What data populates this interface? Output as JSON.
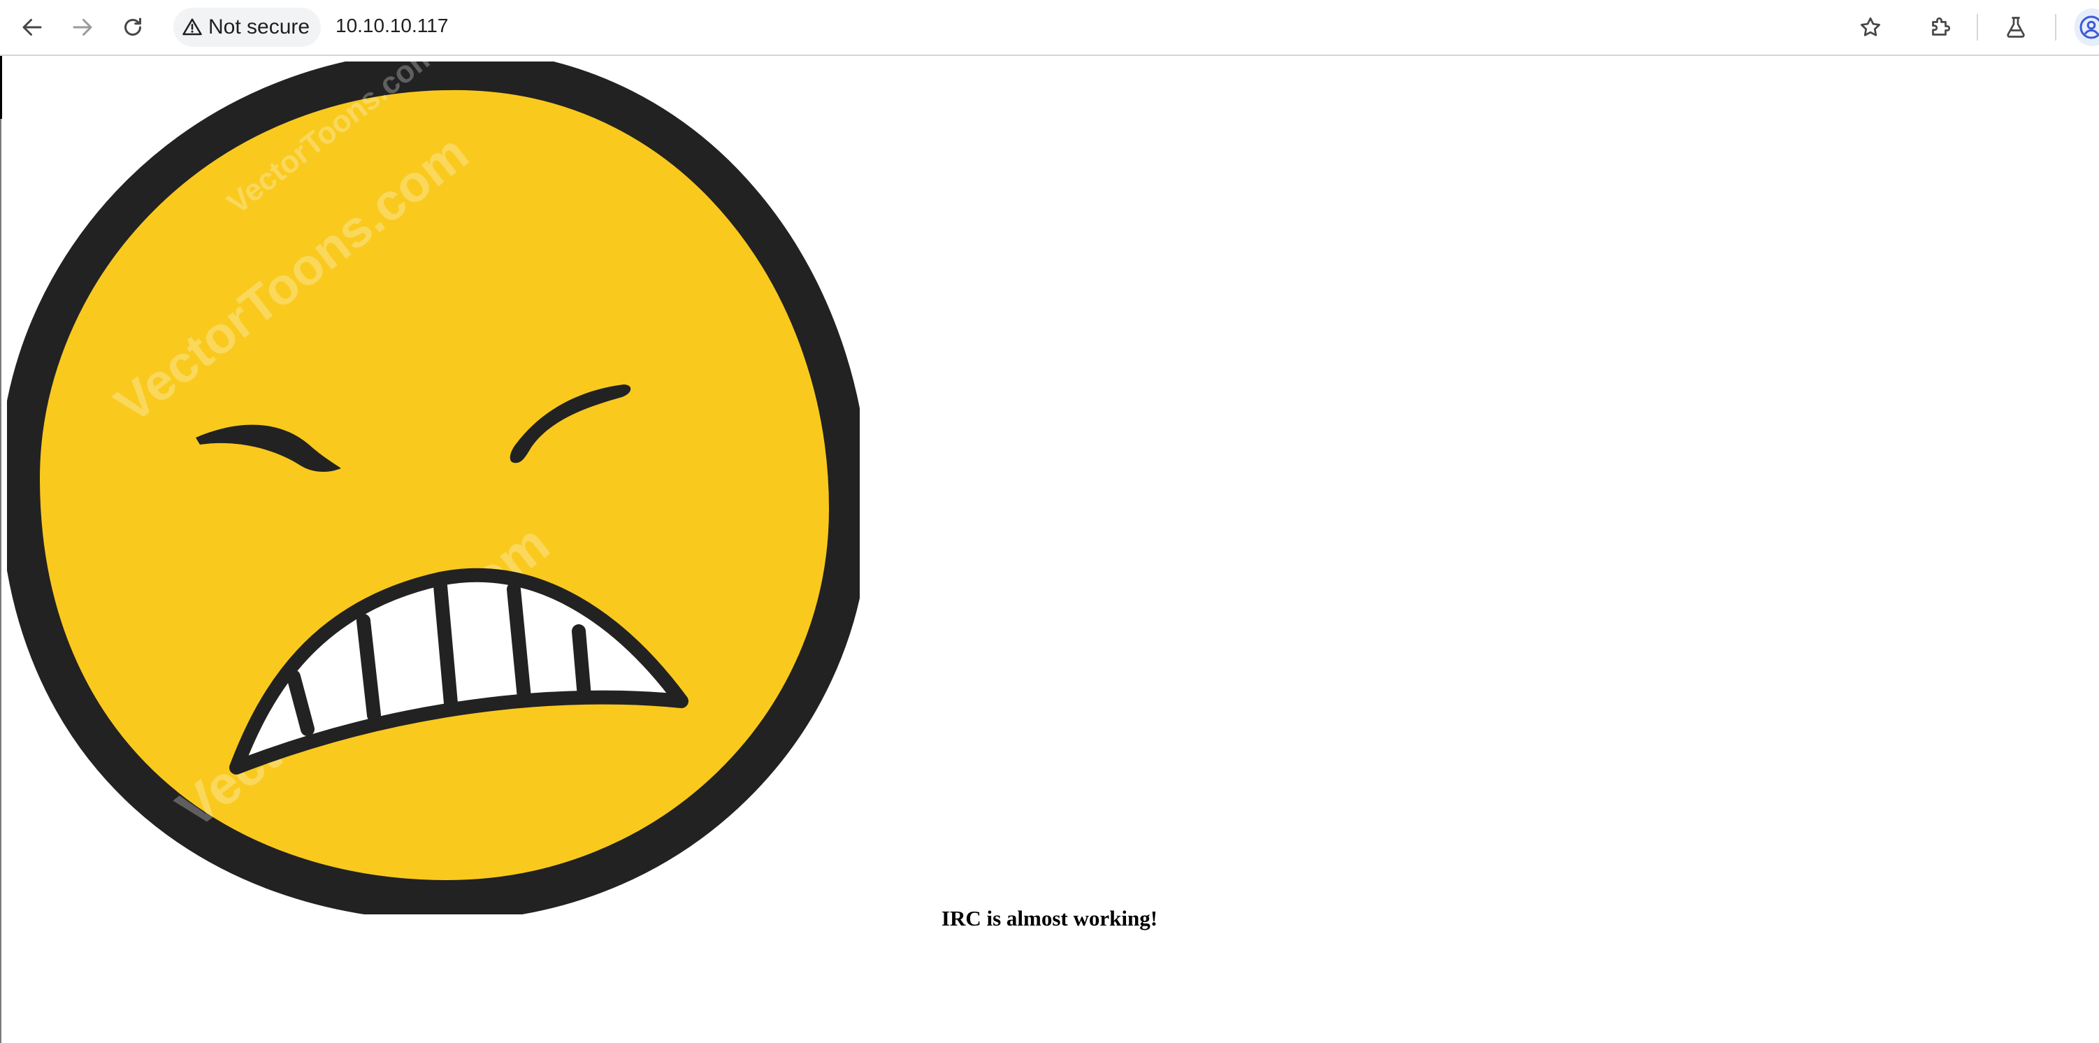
{
  "browser": {
    "security_label": "Not secure",
    "url": "10.10.10.117",
    "buttons": [
      "back",
      "forward",
      "reload",
      "bookmark",
      "extensions",
      "labs",
      "profile"
    ]
  },
  "page": {
    "image": {
      "subject": "angry grimacing emoji face",
      "fill_color": "#F9C91E",
      "outline_color": "#222222",
      "teeth_color": "#FFFFFF",
      "watermark": "VectorToons.com"
    },
    "message": "IRC is almost working!"
  }
}
